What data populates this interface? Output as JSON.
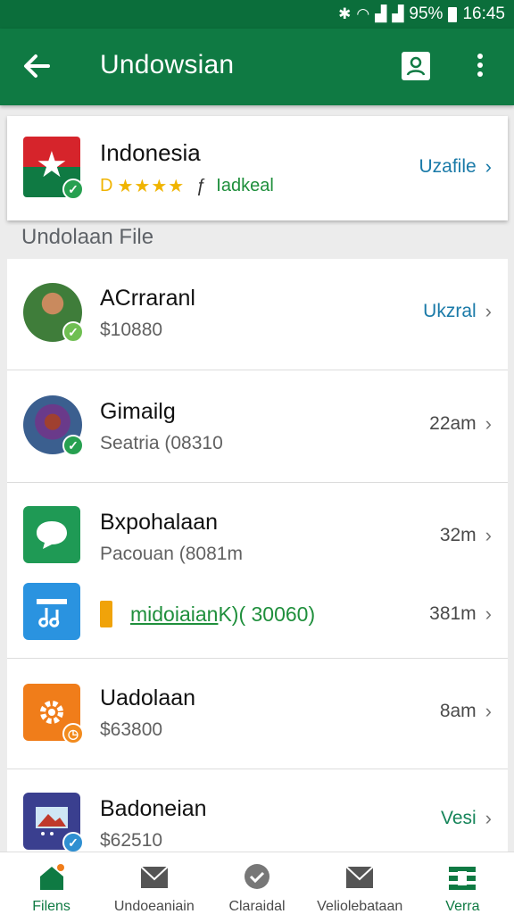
{
  "status_bar": {
    "battery_text": "95%",
    "time": "16:45"
  },
  "app_bar": {
    "title": "Undowsian"
  },
  "featured": {
    "name": "Indonesia",
    "stars": "★★★★",
    "rating_prefix": "D",
    "rating_sep": "ƒ",
    "tag": "Iadkeal",
    "action_label": "Uzafile"
  },
  "section": {
    "label": "Undolaan File"
  },
  "list": [
    {
      "title": "ACrraranl",
      "subtitle": "$10880",
      "meta": "Ukzral",
      "meta_color": "#1a7aa8"
    },
    {
      "title": "Gimailg",
      "subtitle": "Seatria (08310",
      "meta": "22am",
      "meta_color": "#4a4a4a"
    },
    {
      "title": "Bxpohalaan",
      "subtitle": "Pacouan (8081m",
      "meta": "32m",
      "meta_color": "#4a4a4a",
      "secondary": {
        "text": "midoiaian",
        "suffix": "K)( 30060)",
        "meta": "381m"
      }
    },
    {
      "title": "Uadolaan",
      "subtitle": "$63800",
      "meta": "8am",
      "meta_color": "#4a4a4a"
    },
    {
      "title": "Badoneian",
      "subtitle": "$62510",
      "meta": "Vesi",
      "meta_color": "#16855a"
    }
  ],
  "bottom_nav": [
    {
      "label": "Filens",
      "icon": "home-icon",
      "active": true
    },
    {
      "label": "Undoeaniain",
      "icon": "mail-icon",
      "active": false
    },
    {
      "label": "Claraidal",
      "icon": "chat-icon",
      "active": false
    },
    {
      "label": "Veliolebataan",
      "icon": "mail-icon",
      "active": false
    },
    {
      "label": "Verra",
      "icon": "grid-icon",
      "active": true
    }
  ],
  "colors": {
    "primary": "#0f7a43",
    "status_bar": "#0b6e3b",
    "accent": "#1a7aa8",
    "star": "#f0b400"
  }
}
